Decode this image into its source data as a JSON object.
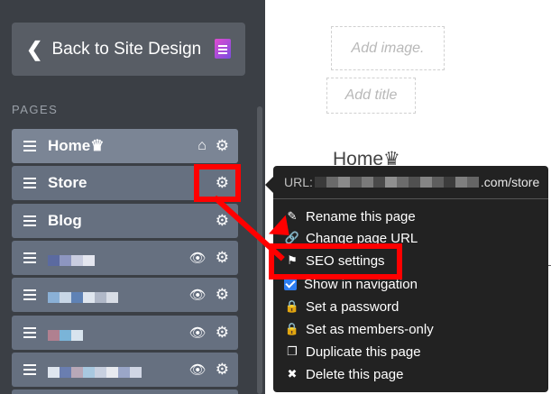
{
  "sidebar": {
    "back_label": "Back to Site Design",
    "pages_label": "PAGES",
    "pages": [
      {
        "name": "Home♛",
        "icons": [
          "home-icon",
          "gear-icon"
        ]
      },
      {
        "name": "Store",
        "icons": [
          "gear-icon"
        ]
      },
      {
        "name": "Blog",
        "icons": [
          "gear-icon"
        ]
      },
      {
        "name": "",
        "icons": [
          "eye-slash-icon",
          "gear-icon"
        ]
      },
      {
        "name": "",
        "icons": [
          "eye-slash-icon",
          "gear-icon"
        ]
      },
      {
        "name": "",
        "icons": [
          "eye-slash-icon",
          "gear-icon"
        ]
      },
      {
        "name": "",
        "icons": [
          "eye-slash-icon",
          "gear-icon"
        ]
      }
    ]
  },
  "content": {
    "add_image": "Add image.",
    "add_title": "Add title",
    "heading": "Home♛"
  },
  "menu": {
    "url_prefix": "URL:",
    "url_suffix": ".com/store",
    "items": [
      {
        "label": "Rename this page",
        "icon": "pencil-icon"
      },
      {
        "label": "Change page URL",
        "icon": "link-icon"
      },
      {
        "label": "SEO settings",
        "icon": "tag-icon"
      },
      {
        "label": "Show in navigation",
        "icon": "checkbox-icon"
      },
      {
        "label": "Set a password",
        "icon": "lock-icon"
      },
      {
        "label": "Set as members-only",
        "icon": "lock-icon"
      },
      {
        "label": "Duplicate this page",
        "icon": "copy-icon"
      },
      {
        "label": "Delete this page",
        "icon": "close-icon"
      }
    ]
  },
  "colors": {
    "highlight": "#ff0000",
    "sidebar_bg": "#3b3f45",
    "row_bg": "#667080",
    "menu_bg": "#222222",
    "checkbox": "#2d7df0"
  }
}
